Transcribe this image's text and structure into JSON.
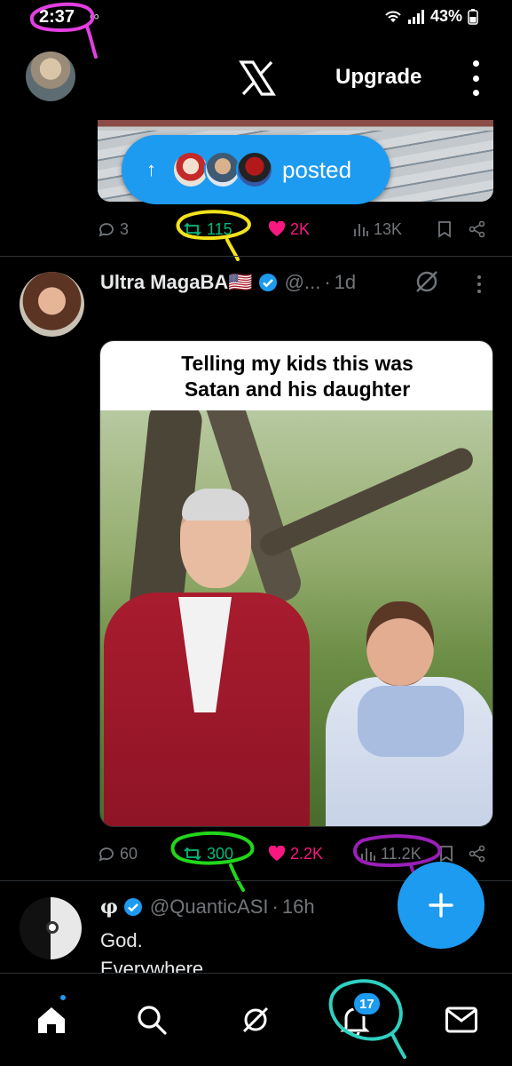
{
  "status_bar": {
    "time": "2:37",
    "link_glyph": "∞",
    "battery": "43%",
    "icons": [
      "wifi-icon",
      "signal-icon",
      "battery-icon"
    ]
  },
  "header": {
    "logo": "X",
    "upgrade_label": "Upgrade"
  },
  "posted_pill": {
    "arrow": "↑",
    "label": "posted"
  },
  "post1": {
    "replies": "3",
    "reposts": "115",
    "likes": "2K",
    "views": "13K"
  },
  "post2": {
    "name": "Ultra MagaBA🇺🇸",
    "handle": "@...",
    "separator": "·",
    "time": "1d",
    "meme_caption_line1": "Telling my kids this was",
    "meme_caption_line2": "Satan and his daughter",
    "replies": "60",
    "reposts": "300",
    "likes": "2.2K",
    "views": "11.2K"
  },
  "post3": {
    "name": "φ",
    "handle": "@QuanticASI",
    "separator": "·",
    "time": "16h",
    "text_line1": "God.",
    "text_line2": "Everywhere"
  },
  "bottom_nav": {
    "notifications_badge": "17",
    "items": [
      "home-icon",
      "search-icon",
      "grok-icon",
      "notifications-icon",
      "messages-icon"
    ]
  },
  "colors": {
    "accent": "#1d9bf0",
    "repost": "#00ba7c",
    "like": "#f91880",
    "muted": "#71767b",
    "annotation_magenta": "#e23fe0",
    "annotation_yellow": "#f3e21b",
    "annotation_green": "#22d61a",
    "annotation_purple": "#9b1fb8",
    "annotation_teal": "#2fd0c0"
  }
}
